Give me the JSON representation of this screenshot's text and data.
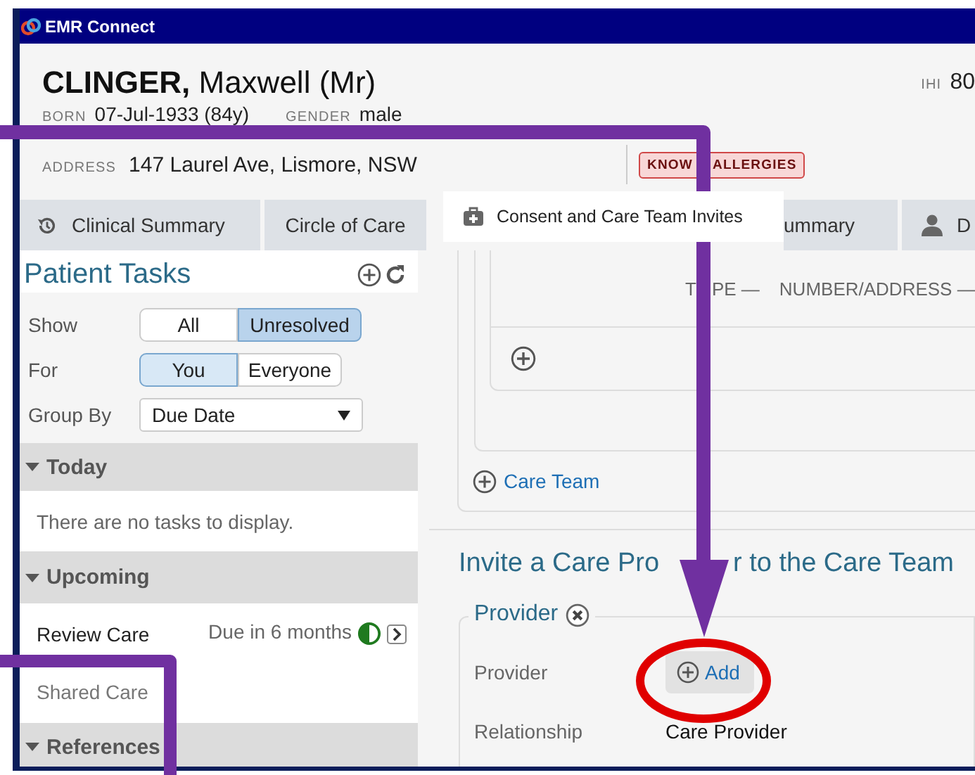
{
  "window": {
    "title": "EMR Connect"
  },
  "patient": {
    "surname": "CLINGER,",
    "given": "Maxwell (Mr)",
    "ihi_label": "IHI",
    "ihi_value": "80",
    "born_label": "BORN",
    "born": "07-Jul-1933 (84y)",
    "gender_label": "GENDER",
    "gender": "male",
    "address_label": "ADDRESS",
    "address": "147 Laurel Ave, Lismore, NSW",
    "alert_parts": [
      "KNOW",
      "ALLERGIES"
    ]
  },
  "tabs": [
    {
      "label": "Clinical Summary",
      "selected": false
    },
    {
      "label": "Circle of Care",
      "selected": false
    },
    {
      "label": "ummary",
      "selected": false
    },
    {
      "label": "D",
      "selected": false
    }
  ],
  "dragged_tab": {
    "label": "Consent and Care Team Invites"
  },
  "tasks": {
    "title": "Patient Tasks",
    "filters": [
      {
        "label": "Show",
        "kind": "toggle",
        "options": [
          {
            "label": "All",
            "selected": false
          },
          {
            "label": "Unresolved",
            "selected": true
          }
        ]
      },
      {
        "label": "For",
        "kind": "toggle",
        "options": [
          {
            "label": "You",
            "selected": true
          },
          {
            "label": "Everyone",
            "selected": false
          }
        ]
      },
      {
        "label": "Group By",
        "kind": "select",
        "value": "Due Date"
      }
    ],
    "groups": [
      {
        "title": "Today",
        "expanded": true,
        "empty_text": "There are no tasks to display."
      },
      {
        "title": "Upcoming",
        "expanded": true,
        "items": [
          {
            "title": "Review Care",
            "due": "Due in 6 months",
            "subtitle": "Shared Care"
          }
        ]
      },
      {
        "title": "References",
        "expanded": true
      }
    ]
  },
  "contacts": {
    "column_1_parts": [
      "T",
      "PE —"
    ],
    "column_2": "NUMBER/ADDRESS —"
  },
  "care_team_link": "Care Team",
  "invite": {
    "title_parts": [
      "Invite a Care Pro",
      "r to the Care Team"
    ],
    "legend": "Provider",
    "rows": [
      {
        "label": "Provider",
        "kind": "button",
        "value": "Add"
      },
      {
        "label": "Relationship",
        "kind": "text",
        "value": "Care Provider"
      }
    ]
  }
}
